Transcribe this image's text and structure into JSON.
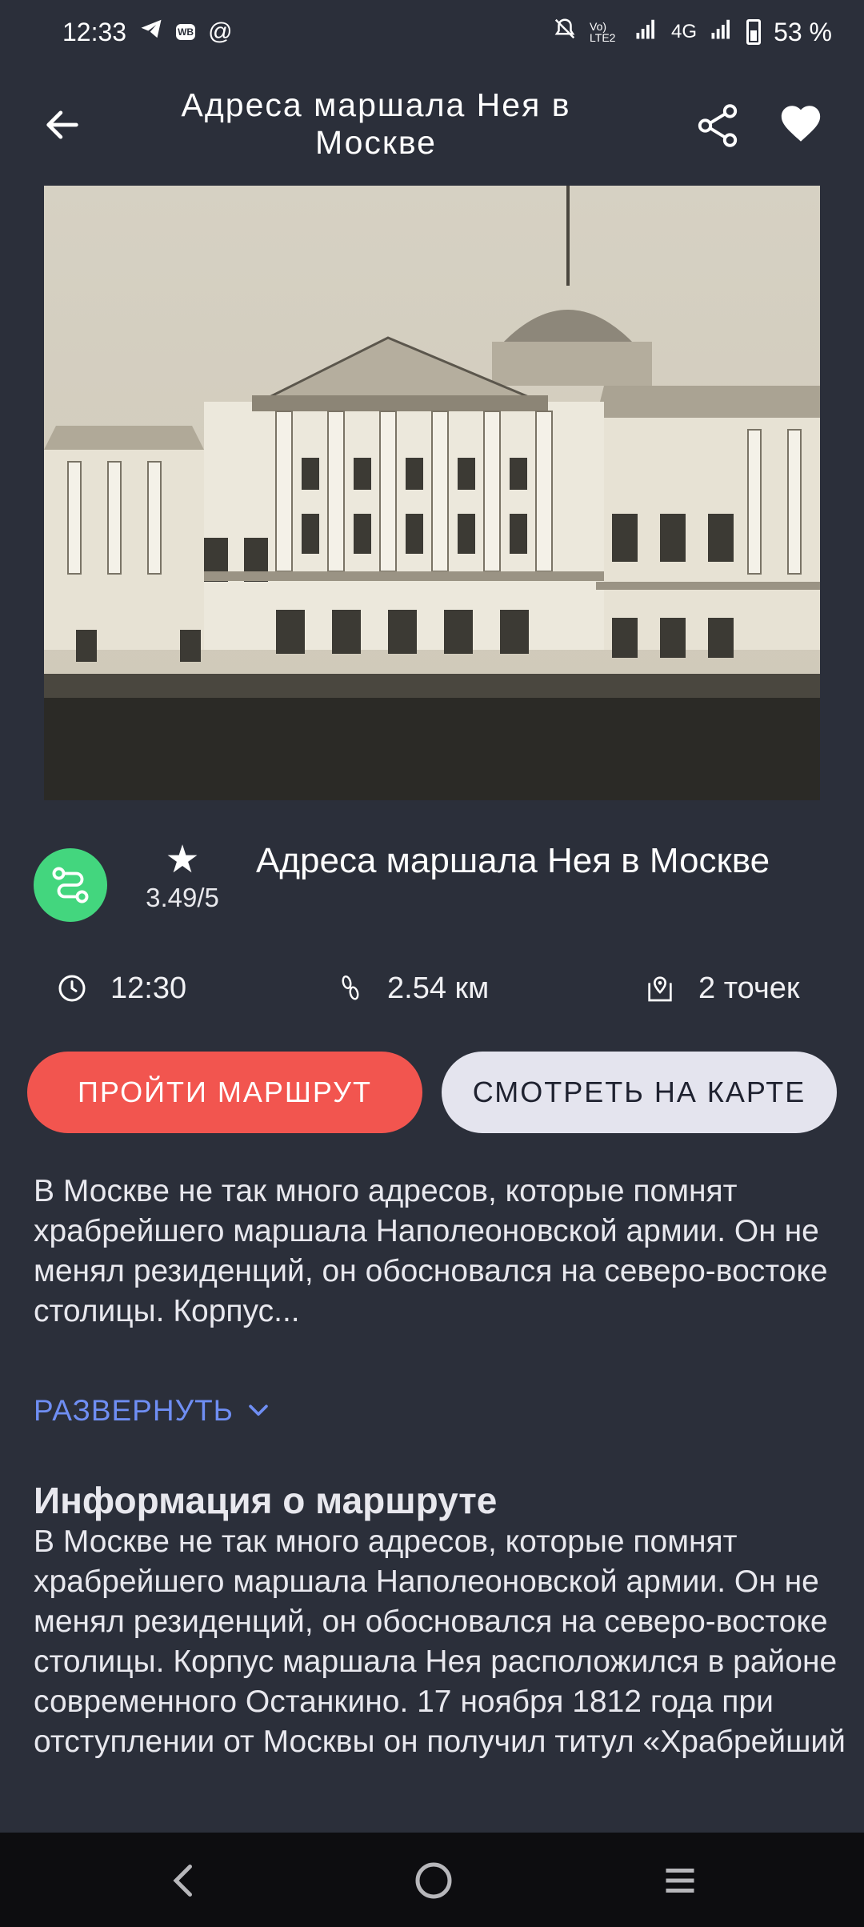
{
  "status_bar": {
    "time": "12:33",
    "battery": "53 %",
    "network": "4G",
    "left_icons": [
      "telegram-icon",
      "wb-icon",
      "at-icon"
    ],
    "right_icons": [
      "mute-icon",
      "volte-icon",
      "signal-icon",
      "signal-icon",
      "battery-icon"
    ],
    "wb_label": "WB",
    "at_label": "@",
    "volte_label": "Vo) LTE2"
  },
  "header": {
    "title": "Адреса маршала Нея в Москве",
    "icons": {
      "back": "arrow-left-icon",
      "share": "share-icon",
      "favorite": "heart-icon"
    }
  },
  "route": {
    "rating_star": "★",
    "rating": "3.49/5",
    "title": "Адреса маршала Нея в Москве",
    "duration": "12:30",
    "distance": "2.54 км",
    "points": "2 точек",
    "badge_color": "#43d67e"
  },
  "actions": {
    "walk_label": "ПРОЙТИ МАРШРУТ",
    "map_label": "СМОТРЕТЬ НА КАРТЕ",
    "walk_color": "#f2554f"
  },
  "description": {
    "short": "В Москве не так много адресов, которые помнят храбрейшего маршала Наполеоновской армии. Он не менял резиденций, он обосновался на северо-востоке столицы. Корпус...",
    "expand_label": "РАЗВЕРНУТЬ"
  },
  "info": {
    "title": "Информация о маршруте",
    "text": "В Москве не так много адресов, которые помнят храбрейшего маршала Наполеоновской армии. Он не менял резиденций, он обосновался на северо-востоке столицы. Корпус маршала Нея расположился в районе современного Останкино. 17 ноября 1812 года при отступлении от Москвы он получил титул «Храбрейший"
  }
}
